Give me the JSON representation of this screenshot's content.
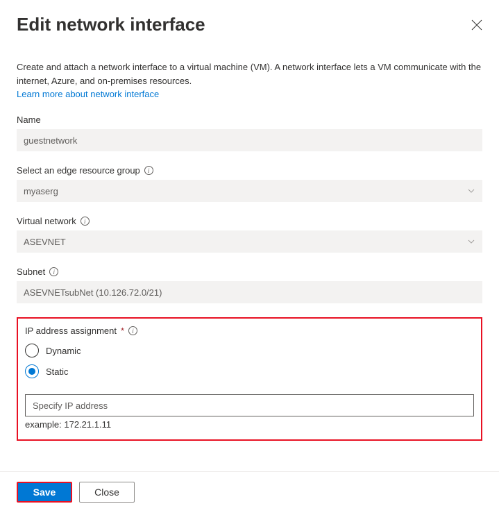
{
  "header": {
    "title": "Edit network interface"
  },
  "description": "Create and attach a network interface to a virtual machine (VM). A network interface lets a VM communicate with the internet, Azure, and on-premises resources.",
  "learnMore": "Learn more about network interface",
  "fields": {
    "name": {
      "label": "Name",
      "value": "guestnetwork"
    },
    "resourceGroup": {
      "label": "Select an edge resource group",
      "value": "myaserg"
    },
    "vnet": {
      "label": "Virtual network",
      "value": "ASEVNET"
    },
    "subnet": {
      "label": "Subnet",
      "value": "ASEVNETsubNet (10.126.72.0/21)"
    },
    "ipAssignment": {
      "label": "IP address assignment",
      "options": {
        "dynamic": "Dynamic",
        "static": "Static"
      },
      "placeholder": "Specify IP address",
      "example": "example: 172.21.1.11"
    }
  },
  "footer": {
    "save": "Save",
    "close": "Close"
  }
}
